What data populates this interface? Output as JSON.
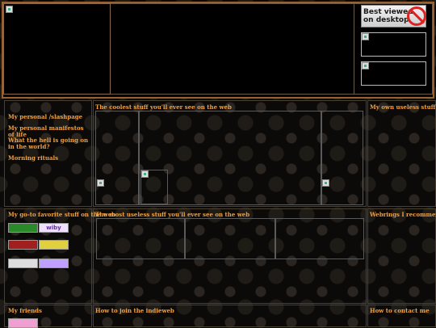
{
  "header": {
    "best_viewed_line1": "Best viewed",
    "best_viewed_line2": "on desktop"
  },
  "sidebar": {
    "links": [
      {
        "label": "My personal /slashpage"
      },
      {
        "label": "My personal manifestos of life"
      },
      {
        "label": "What the hell is going on in the world?"
      },
      {
        "label": "Morning rituals"
      }
    ]
  },
  "sections": {
    "coolest": "The coolest stuff you'll ever see on the web",
    "own_useless": "My own useless stuff on the",
    "goto_fav": "My go-to favorite stuff on the web",
    "most_useless": "The most useless stuff you'll ever see on the web",
    "webrings": "Webrings I recommend",
    "friends": "My friends",
    "join_indieweb": "How to join the indieweb",
    "contact": "How to contact me"
  },
  "buttons": {
    "b1": "",
    "b2": "wiby",
    "b3": "",
    "b4": "",
    "b5": "",
    "b6": "",
    "b7": ""
  },
  "colors": {
    "accent": "#f0a040",
    "header_border": "#9a6030"
  }
}
